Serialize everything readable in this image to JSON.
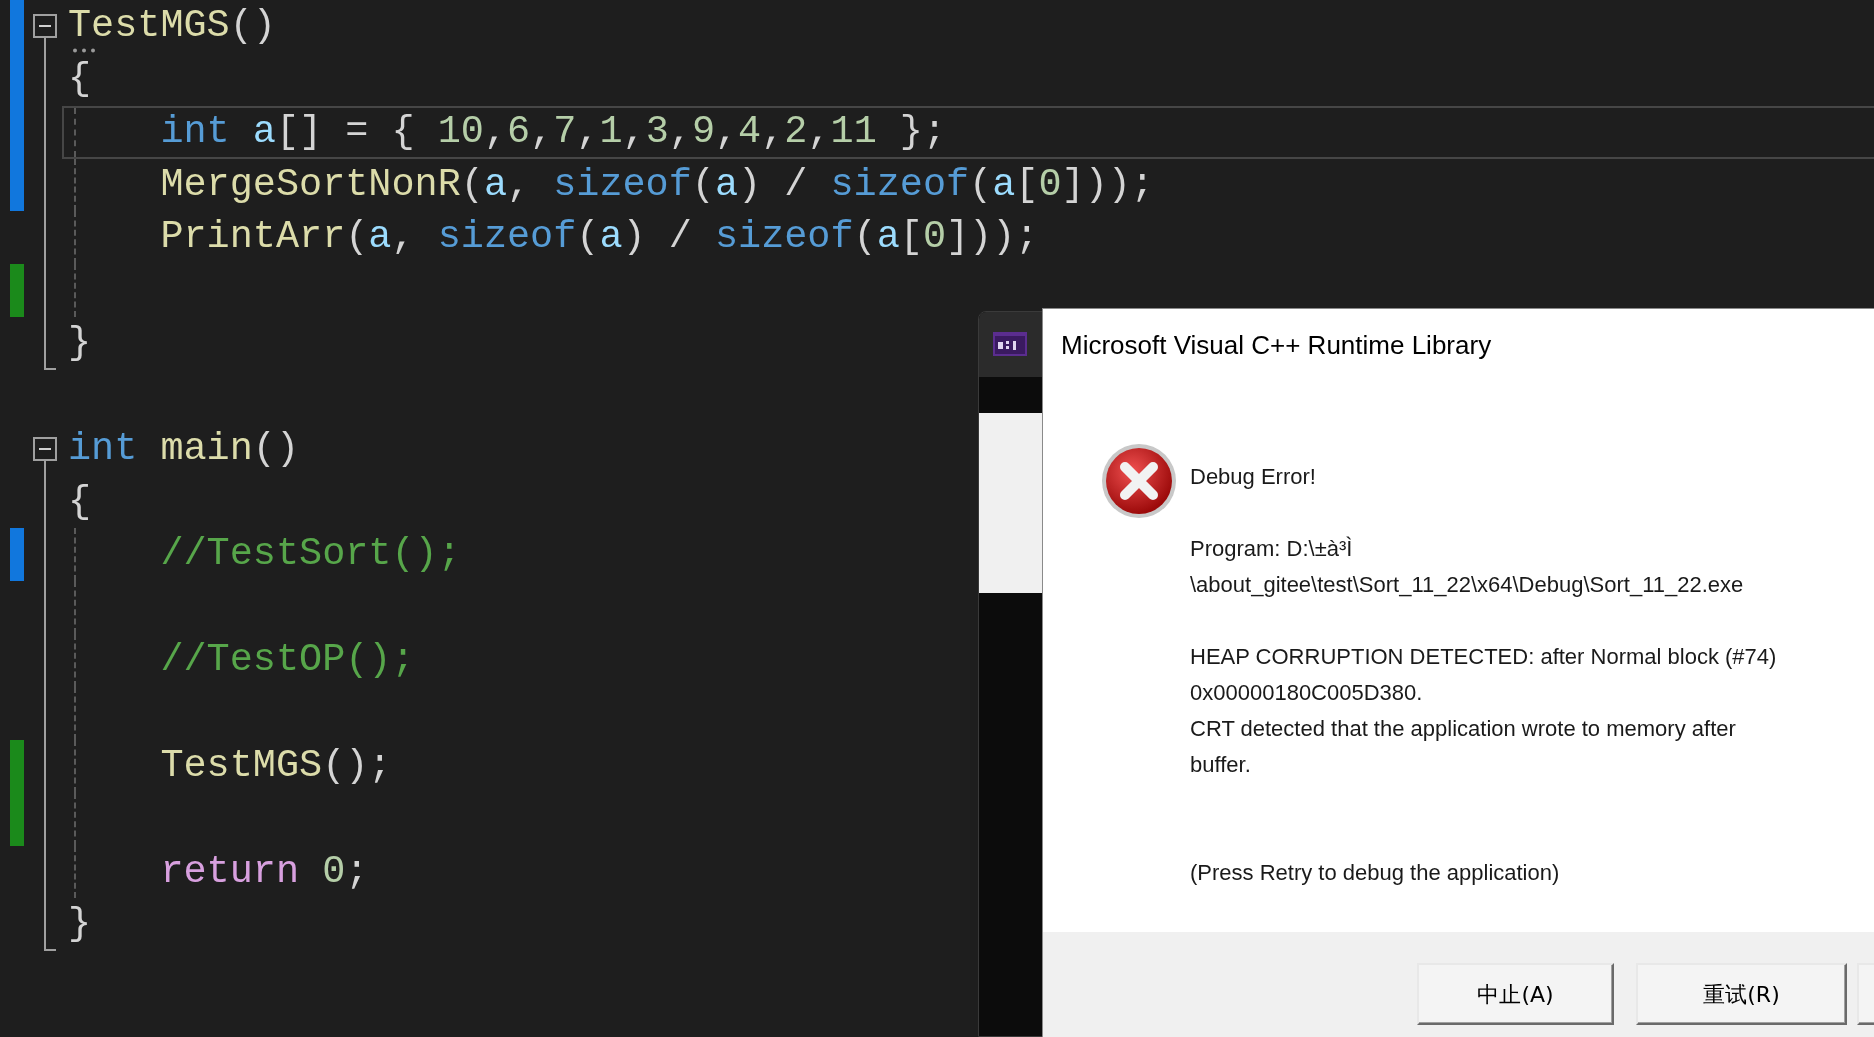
{
  "editor": {
    "items": [
      {
        "kind": "block",
        "header": {
          "kind": "code",
          "tokens": [
            {
              "kind": "func",
              "text": "TestMGS"
            },
            {
              "kind": "punct",
              "text": "()"
            }
          ],
          "color": "#1177dd",
          "suggestion": true
        },
        "open": {
          "kind": "code",
          "tokens": [
            {
              "kind": "punct",
              "text": "{"
            }
          ],
          "color": "#1177dd"
        },
        "children": [
          {
            "kind": "code",
            "tokens": [
              {
                "kind": "kw",
                "text": "int"
              },
              {
                "kind": "var",
                "text": " a"
              },
              {
                "kind": "punct",
                "text": "[] = { "
              },
              {
                "kind": "num",
                "text": "10"
              },
              {
                "kind": "punct",
                "text": ","
              },
              {
                "kind": "num",
                "text": "6"
              },
              {
                "kind": "punct",
                "text": ","
              },
              {
                "kind": "num",
                "text": "7"
              },
              {
                "kind": "punct",
                "text": ","
              },
              {
                "kind": "num",
                "text": "1"
              },
              {
                "kind": "punct",
                "text": ","
              },
              {
                "kind": "num",
                "text": "3"
              },
              {
                "kind": "punct",
                "text": ","
              },
              {
                "kind": "num",
                "text": "9"
              },
              {
                "kind": "punct",
                "text": ","
              },
              {
                "kind": "num",
                "text": "4"
              },
              {
                "kind": "punct",
                "text": ","
              },
              {
                "kind": "num",
                "text": "2"
              },
              {
                "kind": "punct",
                "text": ","
              },
              {
                "kind": "num",
                "text": "11"
              },
              {
                "kind": "punct",
                "text": " };"
              }
            ],
            "color": "#1177dd",
            "current": true
          },
          {
            "kind": "code",
            "tokens": [
              {
                "kind": "func",
                "text": "MergeSortNonR"
              },
              {
                "kind": "punct",
                "text": "("
              },
              {
                "kind": "var",
                "text": "a"
              },
              {
                "kind": "punct",
                "text": ", "
              },
              {
                "kind": "kw",
                "text": "sizeof"
              },
              {
                "kind": "punct",
                "text": "("
              },
              {
                "kind": "var",
                "text": "a"
              },
              {
                "kind": "punct",
                "text": ") / "
              },
              {
                "kind": "kw",
                "text": "sizeof"
              },
              {
                "kind": "punct",
                "text": "("
              },
              {
                "kind": "var",
                "text": "a"
              },
              {
                "kind": "punct",
                "text": "["
              },
              {
                "kind": "num",
                "text": "0"
              },
              {
                "kind": "punct",
                "text": "]));"
              }
            ],
            "color": "#1177dd"
          },
          {
            "kind": "code",
            "tokens": [
              {
                "kind": "func",
                "text": "PrintArr"
              },
              {
                "kind": "punct",
                "text": "("
              },
              {
                "kind": "var",
                "text": "a"
              },
              {
                "kind": "punct",
                "text": ", "
              },
              {
                "kind": "kw",
                "text": "sizeof"
              },
              {
                "kind": "punct",
                "text": "("
              },
              {
                "kind": "var",
                "text": "a"
              },
              {
                "kind": "punct",
                "text": ") / "
              },
              {
                "kind": "kw",
                "text": "sizeof"
              },
              {
                "kind": "punct",
                "text": "("
              },
              {
                "kind": "var",
                "text": "a"
              },
              {
                "kind": "punct",
                "text": "["
              },
              {
                "kind": "num",
                "text": "0"
              },
              {
                "kind": "punct",
                "text": "]));"
              }
            ]
          },
          {
            "kind": "blank",
            "color": "#1b8a1b"
          }
        ],
        "close": {
          "kind": "code",
          "tokens": [
            {
              "kind": "punct",
              "text": "}"
            }
          ]
        }
      },
      {
        "kind": "blank"
      },
      {
        "kind": "block",
        "header": {
          "kind": "code",
          "tokens": [
            {
              "kind": "kw",
              "text": "int"
            },
            {
              "kind": "func",
              "text": " main"
            },
            {
              "kind": "punct",
              "text": "()"
            }
          ]
        },
        "open": {
          "kind": "code",
          "tokens": [
            {
              "kind": "punct",
              "text": "{"
            }
          ]
        },
        "children": [
          {
            "kind": "code",
            "tokens": [
              {
                "kind": "comment",
                "text": "//TestSort();"
              }
            ],
            "color": "#1177dd"
          },
          {
            "kind": "blank"
          },
          {
            "kind": "code",
            "tokens": [
              {
                "kind": "comment",
                "text": "//TestOP();"
              }
            ]
          },
          {
            "kind": "blank"
          },
          {
            "kind": "code",
            "tokens": [
              {
                "kind": "func",
                "text": "TestMGS"
              },
              {
                "kind": "punct",
                "text": "();"
              }
            ],
            "color": "#1b8a1b"
          },
          {
            "kind": "blank",
            "color": "#1b8a1b"
          },
          {
            "kind": "code",
            "tokens": [
              {
                "kind": "ctrl",
                "text": "return"
              },
              {
                "kind": "num",
                "text": " 0"
              },
              {
                "kind": "punct",
                "text": ";"
              }
            ]
          }
        ],
        "close": {
          "kind": "code",
          "tokens": [
            {
              "kind": "punct",
              "text": "}"
            }
          ]
        }
      }
    ]
  },
  "dialog": {
    "title": "Microsoft Visual C++ Runtime Library",
    "paragraphs": [
      {
        "kind": "heading",
        "lines": [
          "Debug Error!"
        ]
      },
      {
        "kind": "text",
        "lines": [
          "Program: D:\\±à³Ì",
          "\\about_gitee\\test\\Sort_11_22\\x64\\Debug\\Sort_11_22.exe"
        ]
      },
      {
        "kind": "text",
        "lines": [
          "HEAP CORRUPTION DETECTED: after Normal block (#74)",
          "0x00000180C005D380.",
          "CRT detected that the application wrote to memory after",
          "buffer."
        ]
      },
      {
        "kind": "hint",
        "lines": [
          "(Press Retry to debug the application)"
        ]
      }
    ],
    "buttons": [
      {
        "label": "中止(A)",
        "cut_off": false
      },
      {
        "label": "重试(R)",
        "cut_off": false
      },
      {
        "cut_off": true
      }
    ]
  }
}
